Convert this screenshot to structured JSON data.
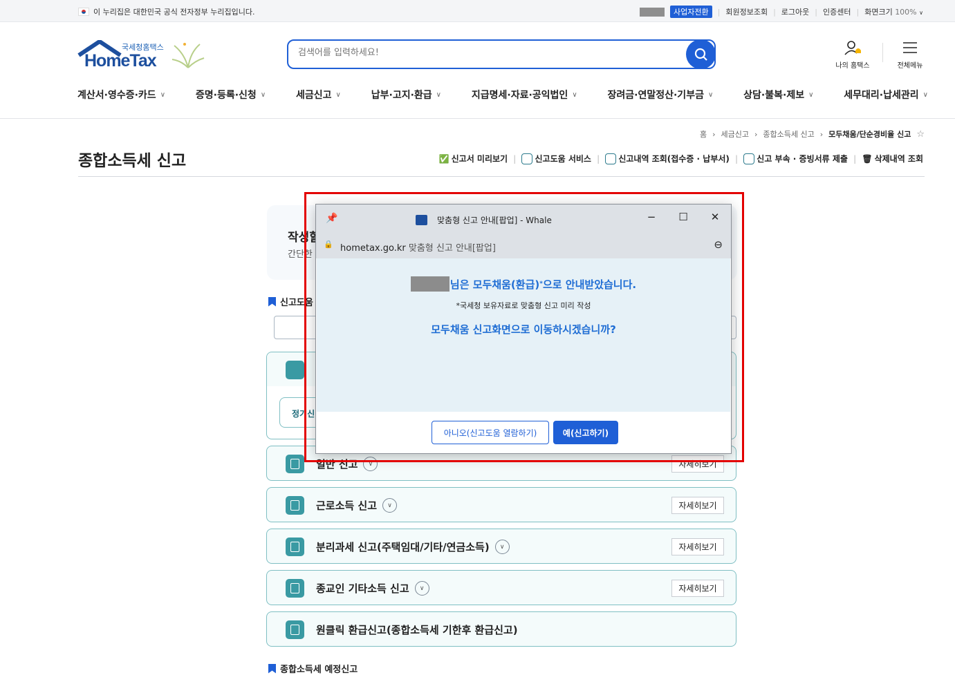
{
  "topbar": {
    "notice": "이 누리집은 대한민국 공식 전자정부 누리집입니다.",
    "biz_switch": "사업자전환",
    "links": [
      "회원정보조회",
      "로그아웃",
      "인증센터"
    ],
    "zoom_label": "화면크기",
    "zoom_value": "100%"
  },
  "logo": {
    "sub": "국세청홈택스",
    "main": "HomeTax"
  },
  "search": {
    "placeholder": "검색어를 입력하세요!"
  },
  "utility": {
    "my_hometax": "나의 홈택스",
    "all_menu": "전체메뉴"
  },
  "gnb": [
    "계산서·영수증·카드",
    "증명·등록·신청",
    "세금신고",
    "납부·고지·환급",
    "지급명세·자료·공익법인",
    "장려금·연말정산·기부금",
    "상담·불복·제보",
    "세무대리·납세관리"
  ],
  "breadcrumb": [
    "홈",
    "세금신고",
    "종합소득세 신고",
    "모두채움/단순경비율 신고"
  ],
  "page_title": "종합소득세 신고",
  "quick_links": [
    "신고서 미리보기",
    "신고도움 서비스",
    "신고내역 조회(접수증 · 납부서)",
    "신고 부속 · 증빙서류 제출",
    "삭제내역 조회"
  ],
  "intro": {
    "title": "작성할",
    "sub": "간단한"
  },
  "sections": {
    "help": "신고도움",
    "expected": "종합소득세 예정신고"
  },
  "big_card_sub": "정기신",
  "cards": [
    {
      "title": "일반 신고",
      "detail": "자세히보기"
    },
    {
      "title": "근로소득 신고",
      "detail": "자세히보기"
    },
    {
      "title": "분리과세 신고(주택임대/기타/연금소득)",
      "detail": "자세히보기"
    },
    {
      "title": "종교인 기타소득 신고",
      "detail": "자세히보기"
    },
    {
      "title": "원클릭 환급신고(종합소득세 기한후 환급신고)",
      "detail": ""
    }
  ],
  "popup": {
    "window_title": "맞춤형 신고 안내[팝업] - Whale",
    "url_host": "hometax.go.kr",
    "url_title": "맞춤형 신고 안내[팝업]",
    "msg1": "님은 모두채움(환급)",
    "msg1_sup": "*",
    "msg1_tail": "으로 안내받았습니다.",
    "msg2": "*국세청 보유자료로 맞춤형 신고 미리 작성",
    "msg3": "모두채움 신고화면으로 이동하시겠습니까?",
    "btn_no": "아니오(신고도움 열람하기)",
    "btn_yes": "예(신고하기)"
  },
  "colors": {
    "primary": "#1f5fd6",
    "teal": "#3a9aa3",
    "highlight": "#e30000"
  }
}
